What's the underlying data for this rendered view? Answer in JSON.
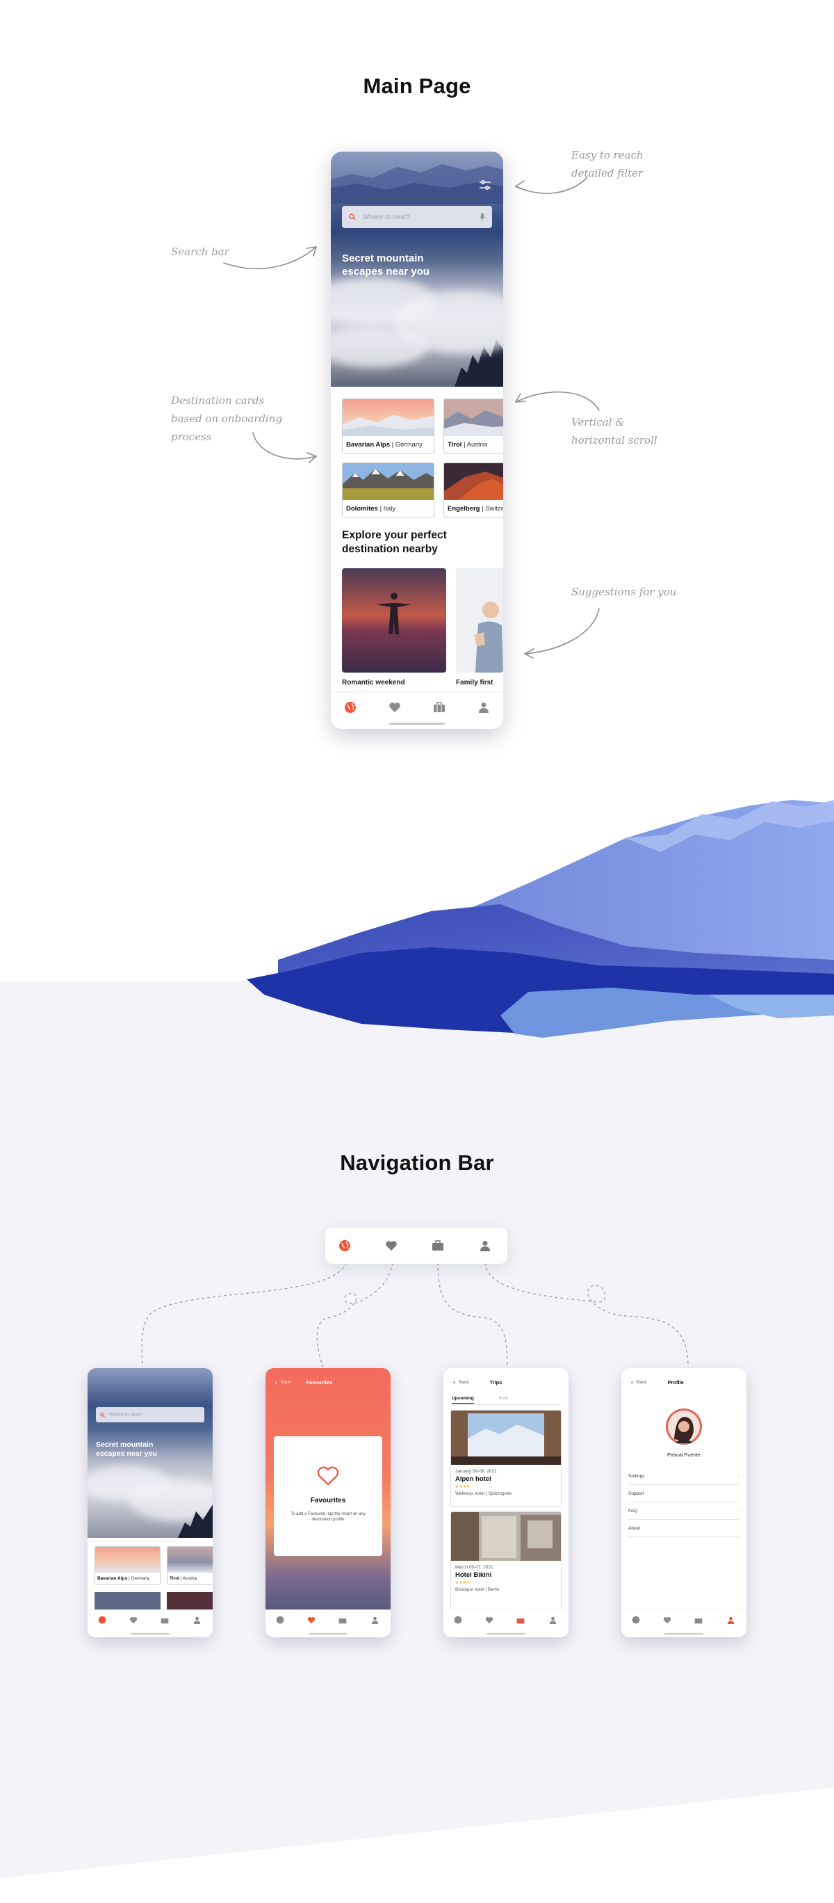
{
  "sections": {
    "main_title": "Main Page",
    "nav_title": "Navigation Bar"
  },
  "annotations": {
    "filter": [
      "Easy to reach",
      "detailed filter"
    ],
    "search": [
      "Search bar"
    ],
    "cards": [
      "Destination cards",
      "based on onboarding",
      "process"
    ],
    "scroll": [
      "Vertical &",
      "horizontal scroll"
    ],
    "suggestions": [
      "Suggestions for you"
    ]
  },
  "app": {
    "search_placeholder": "Where to next?",
    "hero_text": "Secret mountain escapes near you",
    "destinations": [
      {
        "name": "Bavarian Alps",
        "country": "| Germany"
      },
      {
        "name": "Tirol",
        "country": "| Austria"
      },
      {
        "name": "Dolomites",
        "country": "| Italy"
      },
      {
        "name": "Engelberg",
        "country": "| Switzer"
      }
    ],
    "explore_heading": "Explore your perfect destination  nearby",
    "suggestions": [
      {
        "label": "Romantic weekend"
      },
      {
        "label": "Family first"
      }
    ],
    "nav_icons": [
      "globe-icon",
      "heart-icon",
      "briefcase-icon",
      "person-icon"
    ],
    "accent_color": "#f0553a",
    "icon_color": "#8a8a8a"
  },
  "screens": {
    "home": {
      "search_placeholder": "Where to next?",
      "hero_text": "Secret mountain escapes near you",
      "cards": [
        {
          "name": "Bavarian Alps",
          "country": "| Germany"
        },
        {
          "name": "Tirol",
          "country": "| Austria"
        }
      ]
    },
    "favourites": {
      "back": "Back",
      "title": "Favourites",
      "card_title": "Favourites",
      "card_text": "To add a Favourite, tap the Heart on any destination profile"
    },
    "trips": {
      "back": "Back",
      "title": "Trips",
      "tabs": [
        "Upcoming",
        "Past"
      ],
      "items": [
        {
          "date": "January 06-08, 2021",
          "name": "Alpen hotel",
          "stars": "★★★★",
          "desc": "Wellness hotel | Spitzingsee"
        },
        {
          "date": "March 05-07, 2021",
          "name": "Hotel Bikini",
          "stars": "★★★★",
          "desc": "Boutique hotel | Berlin"
        }
      ]
    },
    "profile": {
      "back": "Back",
      "title": "Profile",
      "name": "Pascal Fuente",
      "menu": [
        "Settings",
        "Support",
        "FAQ",
        "About"
      ]
    }
  }
}
